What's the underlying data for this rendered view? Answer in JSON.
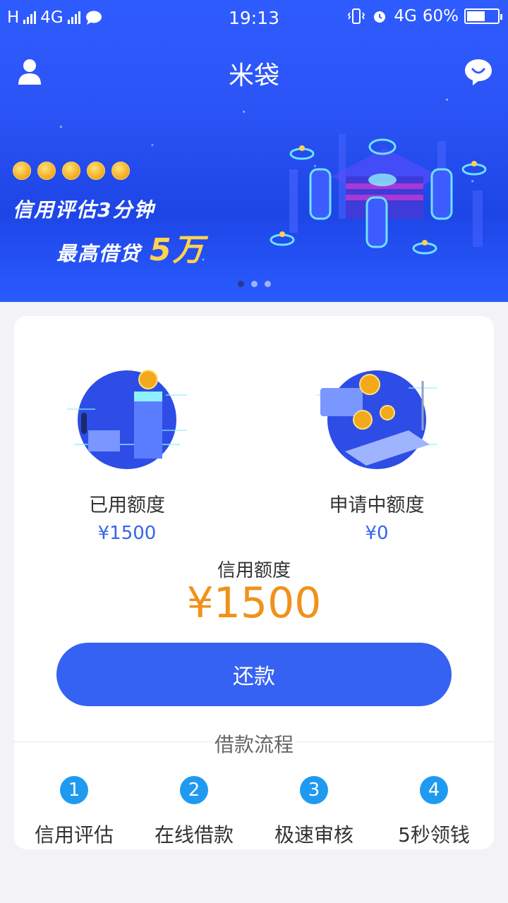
{
  "status_bar": {
    "network_left": "H",
    "network_mid": "4G",
    "time": "19:13",
    "network_right": "4G",
    "battery": "60%",
    "battery_level": 0.6
  },
  "header": {
    "title": "米袋",
    "left_icon": "user-icon",
    "right_icon": "message-icon"
  },
  "banner": {
    "line1": "信用评估3分钟",
    "line2": "最高借贷",
    "highlight": "5万",
    "coin_count": 5,
    "indicator_count": 3,
    "indicator_active": 0
  },
  "quotas": {
    "used": {
      "label": "已用额度",
      "value": "¥1500"
    },
    "pending": {
      "label": "申请中额度",
      "value": "¥0"
    }
  },
  "credit": {
    "label": "信用额度",
    "value": "¥1500"
  },
  "repay_button": "还款",
  "process": {
    "title": "借款流程",
    "steps": [
      {
        "num": "1",
        "label": "信用评估"
      },
      {
        "num": "2",
        "label": "在线借款"
      },
      {
        "num": "3",
        "label": "极速审核"
      },
      {
        "num": "4",
        "label": "5秒领钱"
      }
    ]
  },
  "colors": {
    "brand": "#3562f2",
    "credit_value": "#f0921a",
    "quota_value": "#3566e8",
    "step_badge": "#1f9af0"
  }
}
